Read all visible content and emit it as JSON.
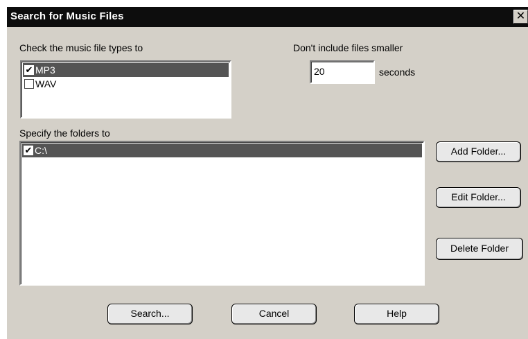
{
  "dialog": {
    "title": "Search for Music Files",
    "close_icon": "close-icon",
    "close_glyph": "✕"
  },
  "file_types": {
    "label": "Check the music file types to",
    "items": [
      {
        "label": "MP3",
        "checked": true,
        "selected": true
      },
      {
        "label": "WAV",
        "checked": false,
        "selected": false
      }
    ]
  },
  "min_size": {
    "label": "Don't include files smaller",
    "value": "20",
    "unit": "seconds"
  },
  "folders": {
    "label": "Specify the folders to",
    "items": [
      {
        "label": "C:\\",
        "checked": true,
        "selected": true
      }
    ],
    "add_label": "Add Folder...",
    "edit_label": "Edit Folder...",
    "delete_label": "Delete Folder"
  },
  "buttons": {
    "search": "Search...",
    "cancel": "Cancel",
    "help": "Help"
  },
  "colors": {
    "title_bg": "#0d0d0d",
    "face": "#d4d0c8",
    "selection": "#545454"
  }
}
